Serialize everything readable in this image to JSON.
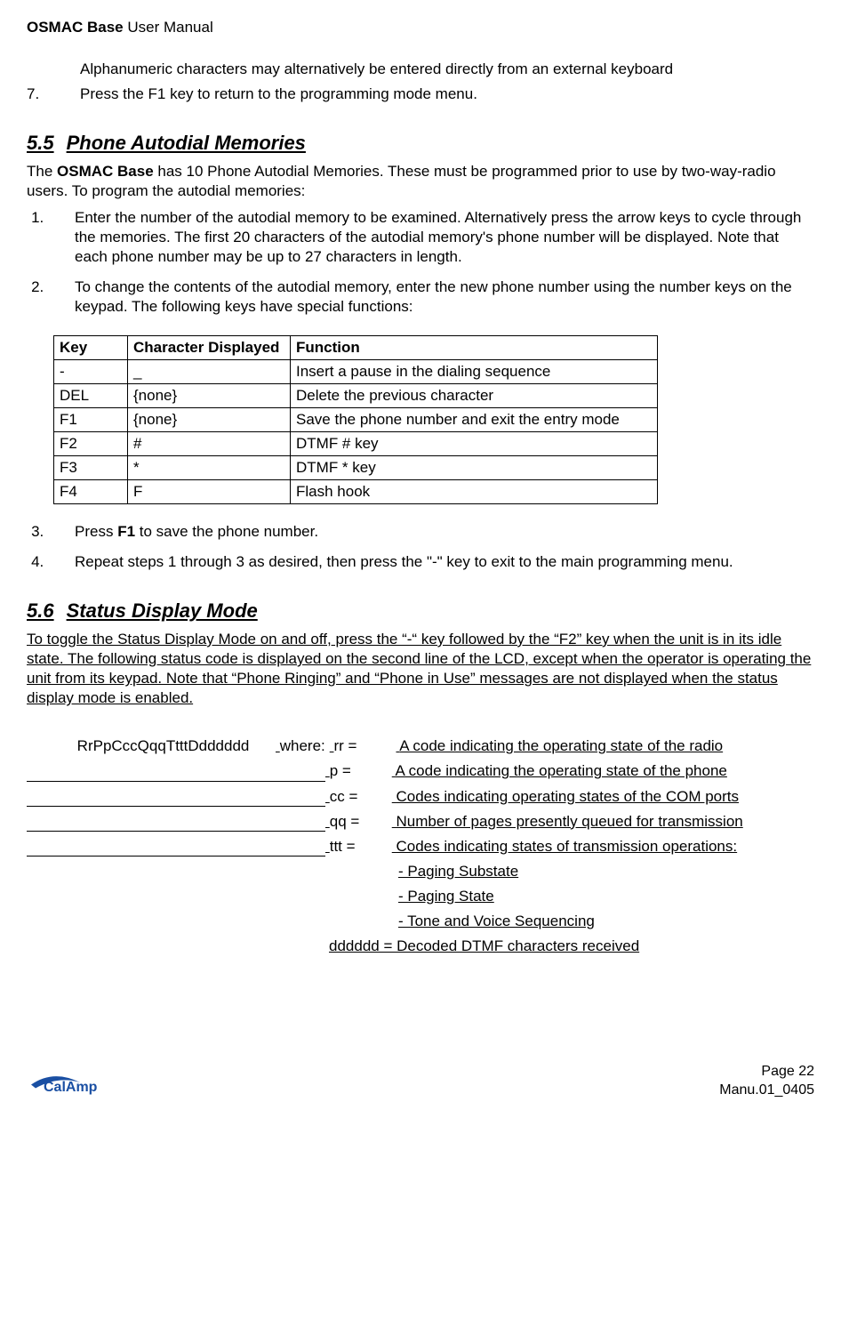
{
  "header": {
    "product": "OSMAC Base",
    "doctype": "User Manual"
  },
  "intro": {
    "note": "Alphanumeric characters may alternatively be entered directly from an external keyboard",
    "step7_num": "7.",
    "step7_text": "Press the F1 key to return to the programming mode menu."
  },
  "sec55": {
    "num": "5.5",
    "title": "Phone Autodial Memories",
    "para": "The OSMAC Base has 10 Phone Autodial Memories.  These must be programmed prior to use by two-way-radio users.  To program the autodial memories:",
    "para_prefix": "The ",
    "para_bold": "OSMAC Base",
    "para_suffix": " has 10 Phone Autodial Memories.  These must be programmed prior to use by two-way-radio users.  To program the autodial memories:",
    "steps": [
      "Enter the number of the autodial memory to be examined.  Alternatively press the arrow keys to cycle through the memories.  The first 20 characters of the autodial memory's phone number will be displayed.  Note that each phone number may be up to 27 characters in length.",
      "To change the contents of the autodial memory, enter the new phone number using the number keys on the keypad.  The following keys have special functions:"
    ],
    "table_headers": {
      "key": "Key",
      "char": "Character Displayed",
      "func": "Function"
    },
    "table_rows": [
      {
        "key": "-",
        "char": "_",
        "func": "Insert a pause in the dialing sequence"
      },
      {
        "key": "DEL",
        "char": "{none}",
        "func": "Delete the previous character"
      },
      {
        "key": "F1",
        "char": "{none}",
        "func": "Save the phone number and exit the entry mode"
      },
      {
        "key": "F2",
        "char": "#",
        "func": "DTMF # key"
      },
      {
        "key": "F3",
        "char": "*",
        "func": "DTMF * key"
      },
      {
        "key": "F4",
        "char": "F",
        "func": "Flash hook"
      }
    ],
    "step3_prefix": "Press ",
    "step3_bold": "F1",
    "step3_suffix": " to save the phone number.",
    "step4": "Repeat steps 1 through 3 as desired, then press the \"-\" key to exit to the main programming menu."
  },
  "sec56": {
    "num": "5.6",
    "title": "Status Display Mode",
    "para": "To toggle the Status Display Mode on and off, press the “-“ key followed by the “F2” key when the unit is in its idle state. The following status code is displayed on the second line of the LCD, except when the operator is operating the unit from its keypad. Note that “Phone Ringing” and “Phone in Use” messages are not displayed when the status display mode is enabled.",
    "code_label": "            RrPpCccQqqTtttDdddddd",
    "where_label": "where:",
    "codes": [
      {
        "sym": "rr =",
        "desc": "A code indicating the operating state of the radio"
      },
      {
        "sym": "p =",
        "desc": "A code indicating the operating state of the phone"
      },
      {
        "sym": "cc =",
        "desc": "Codes indicating operating states of the COM ports"
      },
      {
        "sym": "qq =",
        "desc": "Number of pages presently queued for transmission"
      },
      {
        "sym": "ttt =",
        "desc": "Codes indicating states of transmission operations:"
      }
    ],
    "ttt_sub": [
      "- Paging Substate",
      "- Paging State",
      "- Tone and Voice Sequencing"
    ],
    "dddddd": "dddddd = Decoded DTMF characters received"
  },
  "footer": {
    "page": "Page 22",
    "docid": "Manu.01_0405"
  }
}
